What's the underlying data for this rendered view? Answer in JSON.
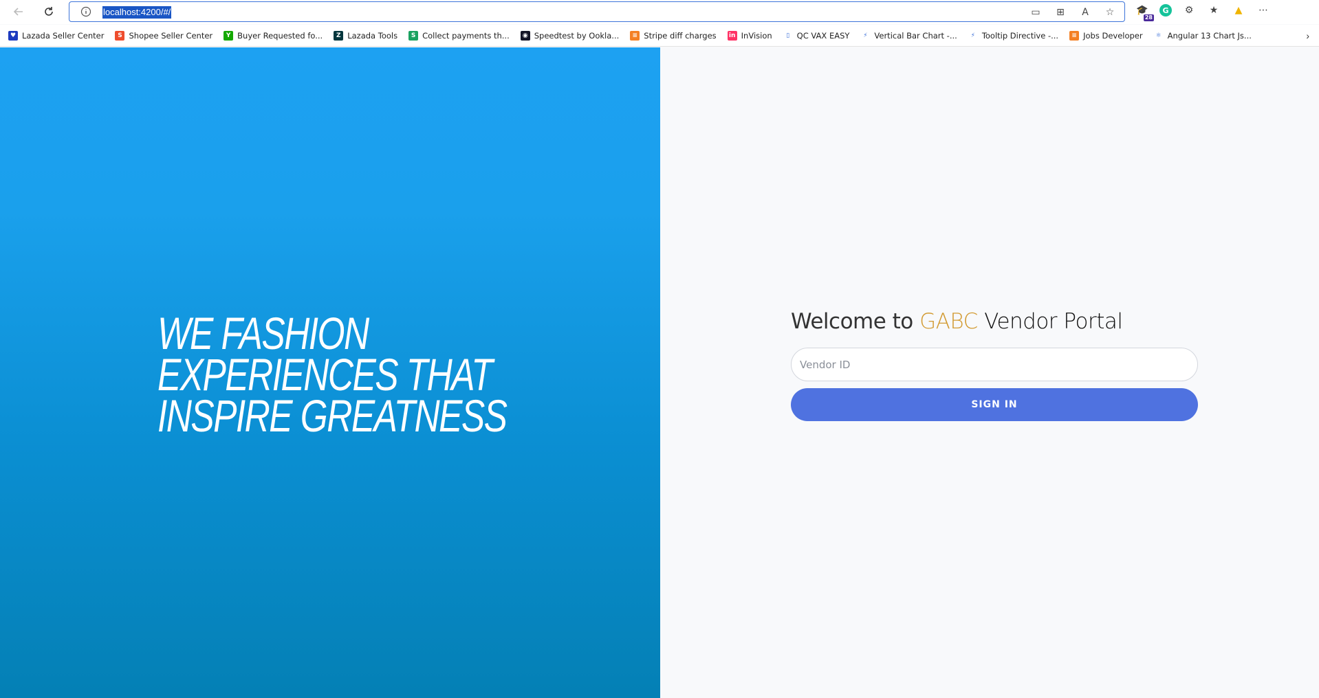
{
  "browser": {
    "url": "localhost:4200/#/",
    "bookmarks": [
      {
        "label": "Lazada Seller Center",
        "color": "#1d3bbf",
        "glyph": "♥"
      },
      {
        "label": "Shopee Seller Center",
        "color": "#ee4d2d",
        "glyph": "S"
      },
      {
        "label": "Buyer Requested fo...",
        "color": "#14a800",
        "glyph": "Y"
      },
      {
        "label": "Lazada Tools",
        "color": "#03363d",
        "glyph": "Z"
      },
      {
        "label": "Collect payments th...",
        "color": "#1aa260",
        "glyph": "S"
      },
      {
        "label": "Speedtest by Ookla...",
        "color": "#141526",
        "glyph": "◉"
      },
      {
        "label": "Stripe diff charges",
        "color": "#f48024",
        "glyph": "≡"
      },
      {
        "label": "InVision",
        "color": "#ff3366",
        "glyph": "in"
      },
      {
        "label": "QC VAX EASY",
        "color": "#ffffff",
        "glyph": "▯"
      },
      {
        "label": "Vertical Bar Chart -...",
        "color": "#ffffff",
        "glyph": "⚡"
      },
      {
        "label": "Tooltip Directive -...",
        "color": "#ffffff",
        "glyph": "⚡"
      },
      {
        "label": "Jobs Developer",
        "color": "#f48024",
        "glyph": "≡"
      },
      {
        "label": "Angular 13 Chart Js...",
        "color": "#ffffff",
        "glyph": "⚛"
      }
    ],
    "extension_badge": "28"
  },
  "hero": {
    "lines": [
      "WE FASHION",
      "EXPERIENCES THAT",
      "INSPIRE GREATNESS"
    ]
  },
  "login": {
    "welcome_prefix": "Welcome to",
    "brand": "GABC",
    "welcome_suffix": "Vendor Portal",
    "vendor_placeholder": "Vendor ID",
    "vendor_value": "",
    "signin_label": "SIGN IN"
  },
  "colors": {
    "hero_top": "#1da1f2",
    "hero_bottom": "#0480b5",
    "brand": "#d29a30",
    "button": "#4f72e0",
    "page_bg": "#f8f9fb"
  }
}
